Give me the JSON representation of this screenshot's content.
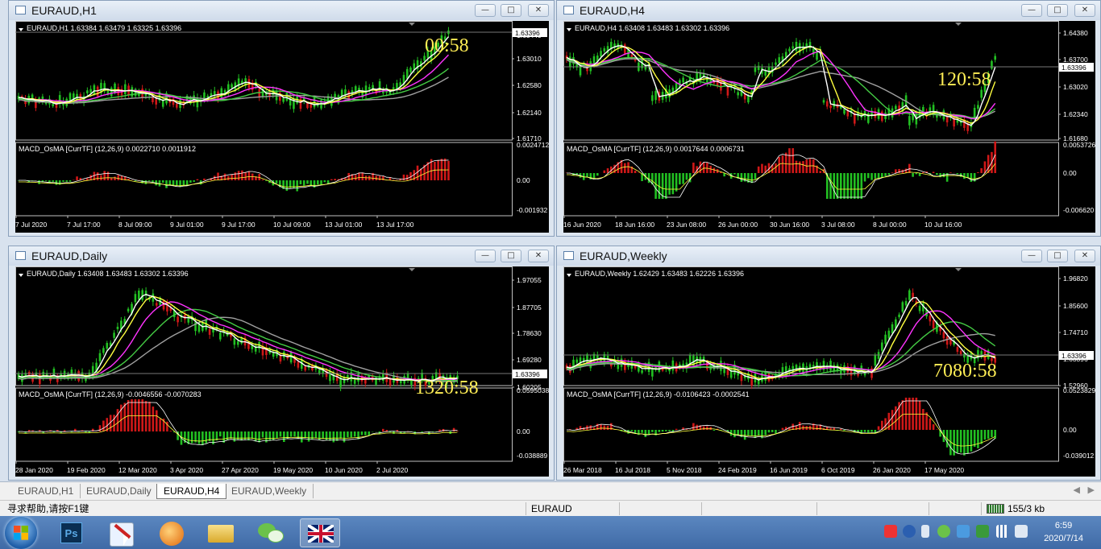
{
  "windows": [
    {
      "title": "EURAUD,H1",
      "info": "EURAUD,H1  1.63384 1.63479 1.63325 1.63396",
      "price_ticks": [
        "1.63440",
        "1.63010",
        "1.62580",
        "1.62140",
        "1.61710"
      ],
      "current_price": "1.63396",
      "timer": "00:58",
      "macd_label": "MACD_OsMA [CurrTF] (12,26,9) 0.0022710 0.0011912",
      "macd_ticks": [
        "0.0024712",
        "0.00",
        "-0.001932"
      ],
      "time_labels": [
        "7 Jul 2020",
        "7 Jul 17:00",
        "8 Jul 09:00",
        "9 Jul 01:00",
        "9 Jul 17:00",
        "10 Jul 09:00",
        "13 Jul 01:00",
        "13 Jul 17:00"
      ]
    },
    {
      "title": "EURAUD,H4",
      "info": "EURAUD,H4  1.63408 1.63483 1.63302 1.63396",
      "price_ticks": [
        "1.64380",
        "1.63700",
        "1.63020",
        "1.62340",
        "1.61680"
      ],
      "current_price": "1.63396",
      "timer": "120:58",
      "macd_label": "MACD_OsMA [CurrTF] (12,26,9) 0.0017644 0.0006731",
      "macd_ticks": [
        "0.0053726",
        "0.00",
        "-0.006620"
      ],
      "time_labels": [
        "16 Jun 2020",
        "18 Jun 16:00",
        "23 Jun 08:00",
        "26 Jun 00:00",
        "30 Jun 16:00",
        "3 Jul 08:00",
        "8 Jul 00:00",
        "10 Jul 16:00"
      ]
    },
    {
      "title": "EURAUD,Daily",
      "info": "EURAUD,Daily  1.63408 1.63483 1.63302 1.63396",
      "price_ticks": [
        "1.97055",
        "1.87705",
        "1.78630",
        "1.69280",
        "1.60205"
      ],
      "current_price": "1.63396",
      "timer": "1320:58",
      "macd_label": "MACD_OsMA [CurrTF] (12,26,9) -0.0046556 -0.0070283",
      "macd_ticks": [
        "0.0595038",
        "0.00",
        "-0.038889"
      ],
      "time_labels": [
        "28 Jan 2020",
        "19 Feb 2020",
        "12 Mar 2020",
        "3 Apr 2020",
        "27 Apr 2020",
        "19 May 2020",
        "10 Jun 2020",
        "2 Jul 2020"
      ]
    },
    {
      "title": "EURAUD,Weekly",
      "info": "EURAUD,Weekly  1.62429 1.63483 1.62226 1.63396",
      "price_ticks": [
        "1.96820",
        "1.85600",
        "1.74710",
        "1.63396",
        "1.52960"
      ],
      "current_price": "1.63396",
      "timer": "7080:58",
      "macd_label": "MACD_OsMA [CurrTF] (12,26,9) -0.0106423 -0.0002541",
      "macd_ticks": [
        "0.0523829",
        "0.00",
        "-0.039012"
      ],
      "time_labels": [
        "26 Mar 2018",
        "16 Jul 2018",
        "5 Nov 2018",
        "24 Feb 2019",
        "16 Jun 2019",
        "6 Oct 2019",
        "26 Jan 2020",
        "17 May 2020"
      ]
    }
  ],
  "tabs": [
    "EURAUD,H1",
    "EURAUD,Daily",
    "EURAUD,H4",
    "EURAUD,Weekly"
  ],
  "active_tab": "EURAUD,H4",
  "status": {
    "help": "寻求帮助,请按F1键",
    "symbol": "EURAUD",
    "traffic": "155/3 kb"
  },
  "clock": {
    "time": "6:59",
    "date": "2020/7/14"
  },
  "colors": {
    "bull": "#22c022",
    "bear": "#d01818",
    "ma_fast": "#ffffff",
    "ma_yellow": "#ffff40",
    "ma_magenta": "#ff33ff",
    "ma_green": "#44cc44",
    "ma_gray": "#a0a0a0",
    "timer": "#ffee55"
  }
}
